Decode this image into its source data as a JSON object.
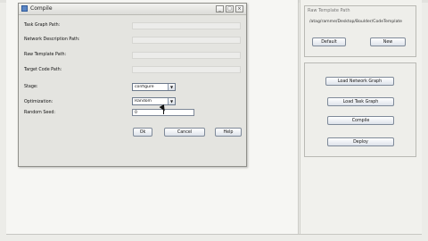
{
  "dialog": {
    "title": "Compile",
    "window_buttons": [
      "_",
      "□",
      "×"
    ],
    "fields": [
      {
        "label": "Task Graph Path:",
        "value": ""
      },
      {
        "label": "Network Description Path:",
        "value": ""
      },
      {
        "label": "Raw Template Path:",
        "value": ""
      },
      {
        "label": "Target Code Path:",
        "value": ""
      }
    ],
    "stage": {
      "label": "Stage:",
      "value": "configure"
    },
    "optimization": {
      "label": "Optimization:",
      "value": "Random"
    },
    "random_seed": {
      "label": "Random Seed:",
      "value": "0"
    },
    "buttons": {
      "ok": "Ok",
      "cancel": "Cancel",
      "help": "Help"
    }
  },
  "right_panel": {
    "template_group": {
      "title": "Raw Template Path",
      "path": "/atag/ramme/Desktop/Boulder/CodeTemplate",
      "default_label": "Default",
      "new_label": "New"
    },
    "actions": {
      "load_network_graph": "Load Network Graph",
      "load_task_graph": "Load Task Graph",
      "compile": "Compile",
      "deploy": "Deploy"
    }
  },
  "colors": {
    "window_bg": "#eeeee9",
    "dialog_bg": "#e4e4e0",
    "button_border": "#7f8a99"
  }
}
